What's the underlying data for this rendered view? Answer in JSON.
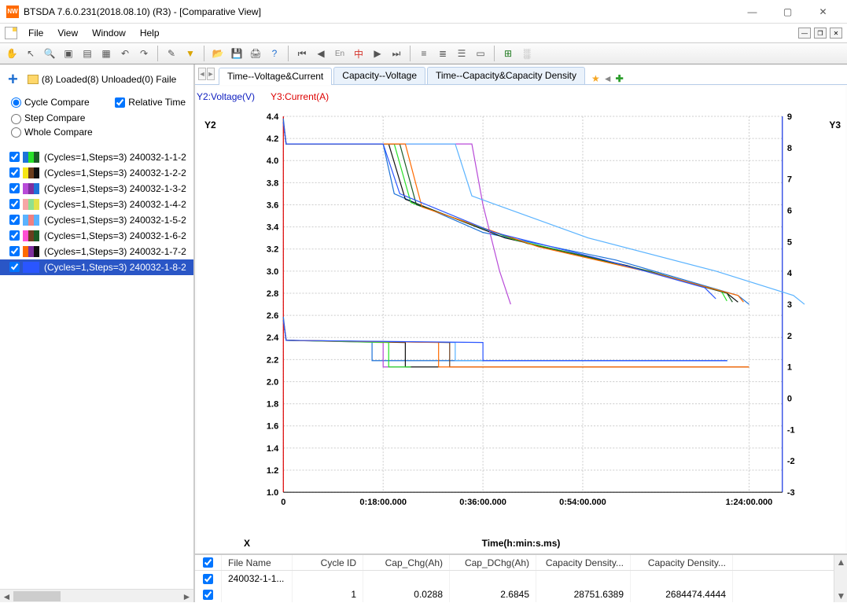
{
  "title": "BTSDA 7.6.0.231(2018.08.10) (R3) - [Comparative View]",
  "menu": {
    "file": "File",
    "view": "View",
    "window": "Window",
    "help": "Help"
  },
  "sidebar": {
    "counts": "(8)  Loaded(8)  Unloaded(0)  Faile",
    "opt_cycle": "Cycle Compare",
    "opt_step": "Step Compare",
    "opt_whole": "Whole Compare",
    "relative": "Relative Time",
    "items": [
      {
        "label": "(Cycles=1,Steps=3)  240032-1-1-2",
        "c1": "#1e73d8",
        "c2": "#28e028",
        "c3": "#1b5c26"
      },
      {
        "label": "(Cycles=1,Steps=3)  240032-1-2-2",
        "c1": "#f6e615",
        "c2": "#6b3d1d",
        "c3": "#111"
      },
      {
        "label": "(Cycles=1,Steps=3)  240032-1-3-2",
        "c1": "#b84bd8",
        "c2": "#7e2f9e",
        "c3": "#1e73d8"
      },
      {
        "label": "(Cycles=1,Steps=3)  240032-1-4-2",
        "c1": "#f6a6a6",
        "c2": "#8fe08f",
        "c3": "#e2e24b"
      },
      {
        "label": "(Cycles=1,Steps=3)  240032-1-5-2",
        "c1": "#5ab3ff",
        "c2": "#f08080",
        "c3": "#5ab3ff"
      },
      {
        "label": "(Cycles=1,Steps=3)  240032-1-6-2",
        "c1": "#ff4fd1",
        "c2": "#6b3d1d",
        "c3": "#1b5c26"
      },
      {
        "label": "(Cycles=1,Steps=3)  240032-1-7-2",
        "c1": "#ff6a00",
        "c2": "#7e2f9e",
        "c3": "#111"
      },
      {
        "label": "(Cycles=1,Steps=3)  240032-1-8-2",
        "c1": "#2a56ff",
        "c2": "#2a56ff",
        "c3": "#2a56ff"
      }
    ]
  },
  "tabs": {
    "t1": "Time--Voltage&Current",
    "t2": "Capacity--Voltage",
    "t3": "Time--Capacity&Capacity Density"
  },
  "chart": {
    "y2label": "Y2:Voltage(V)",
    "y3label": "Y3:Current(A)",
    "y2name": "Y2",
    "y3name": "Y3",
    "xname": "X",
    "xlabel": "Time(h:min:s.ms)"
  },
  "table": {
    "headers": {
      "fn": "File Name",
      "cid": "Cycle ID",
      "cc": "Cap_Chg(Ah)",
      "cd": "Cap_DChg(Ah)",
      "d1": "Capacity Density...",
      "d2": "Capacity Density..."
    },
    "rows": [
      {
        "fn": "240032-1-1...",
        "cid": "",
        "cc": "",
        "cd": "",
        "d1": "",
        "d2": ""
      },
      {
        "fn": "",
        "cid": "1",
        "cc": "0.0288",
        "cd": "2.6845",
        "d1": "28751.6389",
        "d2": "2684474.4444"
      }
    ]
  },
  "chart_data": {
    "type": "line",
    "xlabel": "Time(h:min:s.ms)",
    "x_ticks": [
      "0",
      "0:18:00.000",
      "0:36:00.000",
      "0:54:00.000",
      "1:24:00.000"
    ],
    "y2": {
      "label": "Voltage(V)",
      "ticks": [
        1.0,
        1.2,
        1.4,
        1.6,
        1.8,
        2.0,
        2.2,
        2.4,
        2.6,
        2.8,
        3.0,
        3.2,
        3.4,
        3.6,
        3.8,
        4.0,
        4.2,
        4.4
      ],
      "range": [
        1.0,
        4.4
      ]
    },
    "y3": {
      "label": "Current(A)",
      "ticks": [
        -3,
        -2,
        -1,
        0,
        1,
        2,
        3,
        4,
        5,
        6,
        7,
        8,
        9
      ],
      "range": [
        -3,
        9
      ]
    },
    "note": "Eight channels plotted; voltage traces step from ~4.15 V down to ~2.7 V between ~0:15 and ~1:24; current traces drop from ~1.8 to ~1.0/-3 in steps.",
    "series_voltage": [
      {
        "name": "240032-1-1",
        "color": "#1e73d8",
        "points": [
          [
            0,
            4.38
          ],
          [
            0.5,
            4.15
          ],
          [
            18,
            4.15
          ],
          [
            20,
            3.7
          ],
          [
            36,
            3.35
          ],
          [
            60,
            3.1
          ],
          [
            82,
            2.78
          ],
          [
            84,
            2.7
          ]
        ]
      },
      {
        "name": "240032-1-2",
        "color": "#111111",
        "points": [
          [
            0,
            4.35
          ],
          [
            0.5,
            4.15
          ],
          [
            19,
            4.15
          ],
          [
            22,
            3.65
          ],
          [
            40,
            3.3
          ],
          [
            62,
            3.05
          ],
          [
            80,
            2.8
          ],
          [
            82,
            2.72
          ]
        ]
      },
      {
        "name": "240032-1-3",
        "color": "#b84bd8",
        "points": [
          [
            0,
            4.35
          ],
          [
            0.5,
            4.15
          ],
          [
            34,
            4.15
          ],
          [
            36,
            3.6
          ],
          [
            39,
            3.0
          ],
          [
            40,
            2.85
          ],
          [
            41,
            2.7
          ]
        ]
      },
      {
        "name": "240032-1-4",
        "color": "#28e028",
        "points": [
          [
            0,
            4.35
          ],
          [
            0.5,
            4.15
          ],
          [
            20,
            4.15
          ],
          [
            23,
            3.62
          ],
          [
            42,
            3.28
          ],
          [
            64,
            3.02
          ],
          [
            79,
            2.82
          ],
          [
            80,
            2.73
          ]
        ]
      },
      {
        "name": "240032-1-5",
        "color": "#5ab3ff",
        "points": [
          [
            0,
            4.35
          ],
          [
            0.5,
            4.15
          ],
          [
            31,
            4.15
          ],
          [
            34,
            3.68
          ],
          [
            55,
            3.3
          ],
          [
            78,
            3.0
          ],
          [
            92,
            2.78
          ],
          [
            94,
            2.7
          ]
        ]
      },
      {
        "name": "240032-1-6",
        "color": "#1b5c26",
        "points": [
          [
            0,
            4.35
          ],
          [
            0.5,
            4.15
          ],
          [
            21,
            4.15
          ],
          [
            24,
            3.6
          ],
          [
            44,
            3.25
          ],
          [
            66,
            3.0
          ],
          [
            80,
            2.8
          ],
          [
            81,
            2.72
          ]
        ]
      },
      {
        "name": "240032-1-7",
        "color": "#ff6a00",
        "points": [
          [
            0,
            4.35
          ],
          [
            0.5,
            4.15
          ],
          [
            22,
            4.15
          ],
          [
            25,
            3.58
          ],
          [
            46,
            3.22
          ],
          [
            67,
            2.98
          ],
          [
            82,
            2.78
          ],
          [
            83,
            2.72
          ]
        ]
      },
      {
        "name": "240032-1-8",
        "color": "#2a56ff",
        "points": [
          [
            0,
            4.35
          ],
          [
            0.5,
            4.15
          ],
          [
            18,
            4.15
          ],
          [
            21,
            3.7
          ],
          [
            38,
            3.35
          ],
          [
            58,
            3.1
          ],
          [
            76,
            2.85
          ],
          [
            78,
            2.75
          ]
        ]
      }
    ],
    "series_current": [
      {
        "name": "240032-1-1",
        "color": "#1e73d8",
        "points": [
          [
            0,
            2.6
          ],
          [
            0.5,
            1.85
          ],
          [
            16,
            1.8
          ],
          [
            16,
            1.2
          ],
          [
            80,
            1.2
          ],
          [
            80,
            1.18
          ]
        ]
      },
      {
        "name": "240032-1-2",
        "color": "#111111",
        "points": [
          [
            0,
            2.5
          ],
          [
            0.5,
            1.85
          ],
          [
            22,
            1.78
          ],
          [
            22,
            1.0
          ],
          [
            28,
            1.0
          ],
          [
            28,
            1.0
          ]
        ]
      },
      {
        "name": "240032-1-3",
        "color": "#b84bd8",
        "points": [
          [
            0,
            2.5
          ],
          [
            0.5,
            1.85
          ],
          [
            18,
            1.78
          ],
          [
            18,
            1.0
          ],
          [
            22,
            1.0
          ]
        ]
      },
      {
        "name": "240032-1-4",
        "color": "#28e028",
        "points": [
          [
            0,
            2.5
          ],
          [
            0.5,
            1.85
          ],
          [
            19,
            1.78
          ],
          [
            19,
            1.0
          ],
          [
            23,
            1.0
          ]
        ]
      },
      {
        "name": "240032-1-5",
        "color": "#5ab3ff",
        "points": [
          [
            0,
            2.5
          ],
          [
            0.5,
            1.85
          ],
          [
            31,
            1.78
          ],
          [
            31,
            1.2
          ],
          [
            55,
            1.2
          ]
        ]
      },
      {
        "name": "240032-1-6",
        "color": "#6b3d1d",
        "points": [
          [
            0,
            2.5
          ],
          [
            0.5,
            1.85
          ],
          [
            30,
            1.78
          ],
          [
            30,
            1.0
          ],
          [
            84,
            1.0
          ]
        ]
      },
      {
        "name": "240032-1-7",
        "color": "#ff6a00",
        "points": [
          [
            0,
            2.5
          ],
          [
            0.5,
            1.85
          ],
          [
            28,
            1.78
          ],
          [
            28,
            1.0
          ],
          [
            84,
            1.0
          ]
        ]
      },
      {
        "name": "240032-1-8",
        "color": "#2a56ff",
        "points": [
          [
            0,
            2.5
          ],
          [
            0.5,
            1.85
          ],
          [
            36,
            1.78
          ],
          [
            36,
            1.2
          ],
          [
            80,
            1.2
          ]
        ]
      }
    ]
  }
}
